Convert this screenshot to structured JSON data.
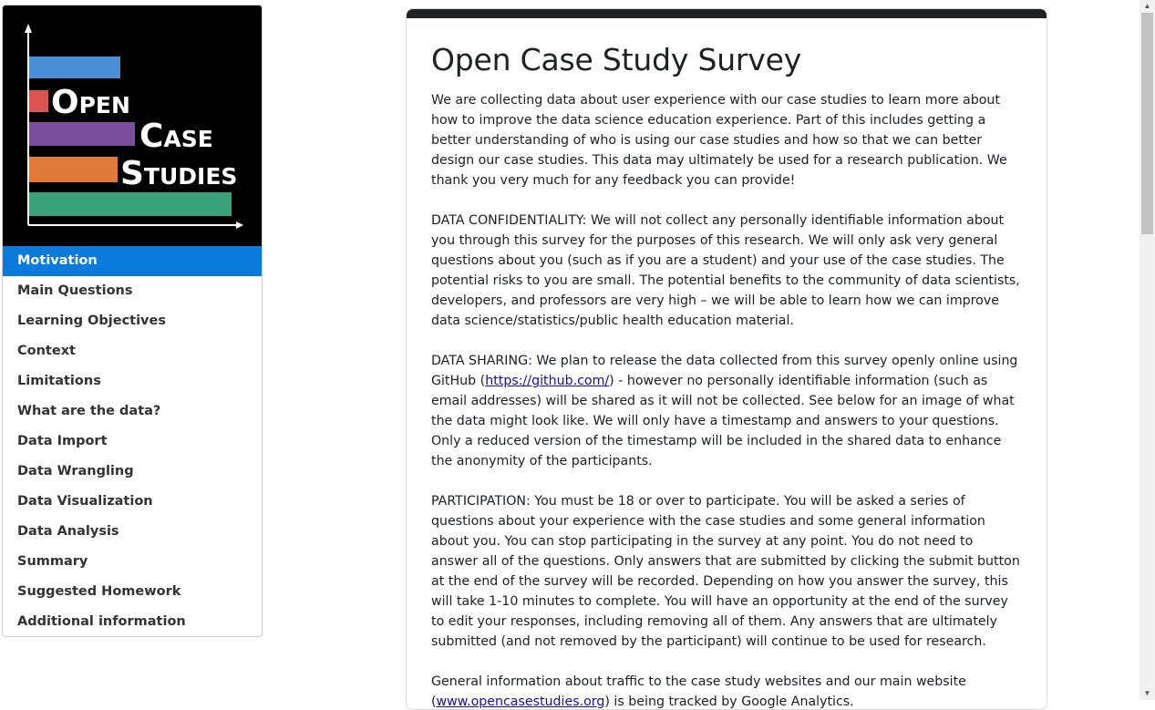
{
  "logo": {
    "line1": "Open",
    "line2": "Case",
    "line3": "Studies",
    "bar_colors": [
      "#4a90d9",
      "#d9534f",
      "#7b4f9d",
      "#e07b39",
      "#3aa27a"
    ]
  },
  "sidebar": {
    "items": [
      {
        "label": "Motivation",
        "active": true
      },
      {
        "label": "Main Questions"
      },
      {
        "label": "Learning Objectives"
      },
      {
        "label": "Context"
      },
      {
        "label": "Limitations"
      },
      {
        "label": "What are the data?"
      },
      {
        "label": "Data Import"
      },
      {
        "label": "Data Wrangling"
      },
      {
        "label": "Data Visualization"
      },
      {
        "label": "Data Analysis"
      },
      {
        "label": "Summary"
      },
      {
        "label": "Suggested Homework"
      },
      {
        "label": "Additional information"
      }
    ]
  },
  "form": {
    "title": "Open Case Study Survey",
    "intro": "We are collecting data about user experience with our case studies to learn more about how to improve the data science education experience. Part of this includes getting a better understanding of who is using our case studies and how so that we can better design our case studies. This data may ultimately be used for a research publication. We thank you very much for any feedback you can provide!",
    "confidentiality": "DATA CONFIDENTIALITY: We will not collect any personally identifiable information about you through this survey for the purposes of this research. We will only ask very general questions about you (such as if you are a student) and your use of the case studies. The potential risks to you are small. The potential benefits to the community of data scientists, developers, and professors are very high – we will be able to learn how we can improve data science/statistics/public health education material.",
    "sharing_pre": "DATA SHARING: We plan to release the data collected from this survey openly online using GitHub (",
    "sharing_link": "https://github.com/",
    "sharing_post": ") - however no personally identifiable information (such as email addresses) will be shared as it will not be collected. See below for an image of what the data might look like. We will only have a timestamp and answers to your questions. Only a reduced version of the timestamp will be included in the shared data to enhance the anonymity of the participants.",
    "participation": "PARTICIPATION: You must be 18 or over to participate. You will be asked a series of questions about your experience with the case studies and some general information about you. You can stop participating in the survey at any point. You do not need to answer all of the questions. Only answers that are submitted by clicking the submit button at the end of the survey will be recorded. Depending on how you answer the survey, this will take 1-10 minutes to complete. You will have an opportunity at the end of the survey to edit your responses, including removing all of them. Any answers that are ultimately submitted (and not removed by the participant) will continue to be used for research.",
    "traffic_pre": "General information about traffic to the case study websites and our main website (",
    "traffic_link": "www.opencasestudies.org",
    "traffic_post": ") is being tracked by Google Analytics."
  }
}
